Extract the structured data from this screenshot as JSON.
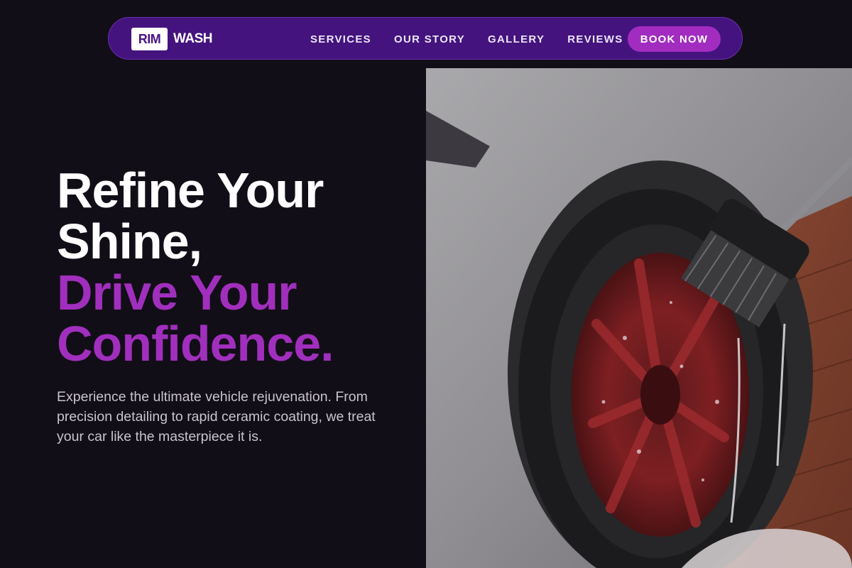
{
  "brand": {
    "logo_box_text": "RIM",
    "logo_word": "WASH"
  },
  "nav": {
    "links": [
      "SERVICES",
      "OUR STORY",
      "GALLERY",
      "REVIEWS"
    ],
    "cta_label": "BOOK NOW"
  },
  "hero": {
    "headline_white_lines": [
      "Refine Your",
      "Shine,"
    ],
    "headline_purple_lines": [
      "Drive Your",
      "Confidence."
    ],
    "subtext": "Experience the ultimate vehicle rejuvenation. From precision detailing to rapid ceramic coating, we treat your car like the masterpiece it is.",
    "image_subject": "car-wheel-brush-wash-photo"
  },
  "colors": {
    "background": "#120e17",
    "nav_background": "#44137e",
    "accent_purple": "#a12fbd",
    "cta_background": "#a22cc0",
    "text_white": "#ffffff",
    "text_muted": "#c8c3d0"
  }
}
